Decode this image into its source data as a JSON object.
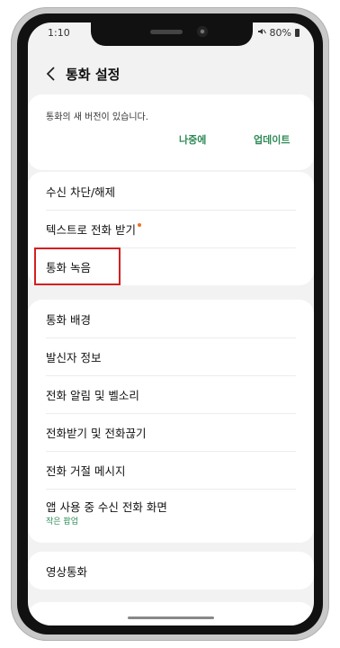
{
  "status_bar": {
    "time": "1:10",
    "battery": "80%",
    "mute_icon": "mute-icon"
  },
  "header": {
    "title": "통화 설정",
    "back_icon": "chevron-left-icon"
  },
  "update_card": {
    "message": "통화의 새 버전이 있습니다.",
    "later_label": "나중에",
    "update_label": "업데이트"
  },
  "group1": {
    "items": [
      {
        "label": "수신 차단/해제"
      },
      {
        "label": "텍스트로 전화 받기"
      },
      {
        "label": "통화 녹음"
      }
    ]
  },
  "group2": {
    "items": [
      {
        "label": "통화 배경"
      },
      {
        "label": "발신자 정보"
      },
      {
        "label": "전화 알림 및 벨소리"
      },
      {
        "label": "전화받기 및 전화끊기"
      },
      {
        "label": "전화 거절 메시지"
      },
      {
        "label": "앱 사용 중 수신 전화 화면",
        "sub": "작은 팝업"
      }
    ]
  },
  "group3": {
    "items": [
      {
        "label": "영상통화"
      }
    ]
  },
  "colors": {
    "accent": "#2e8b57",
    "highlight": "#d32020",
    "new_dot": "#f07020"
  }
}
